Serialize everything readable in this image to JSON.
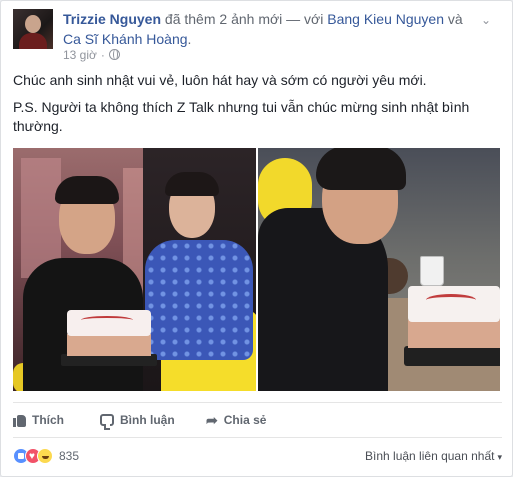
{
  "header": {
    "author": "Trizzie Nguyen",
    "action_text": "đã thêm 2 ảnh mới — với",
    "tagged_1": "Bang Kieu Nguyen",
    "conjunction": "và",
    "tagged_2": "Ca Sĩ Khánh Hoàng",
    "period": ".",
    "time": "13 giờ",
    "separator": "·"
  },
  "post": {
    "line_1": "Chúc anh sinh nhật vui vẻ, luôn hát hay và sớm có người yêu mới.",
    "line_2": "P.S. Người ta không thích Z Talk nhưng tui vẫn chúc mừng sinh nhật bình thường."
  },
  "actions": {
    "like_label": "Thích",
    "comment_label": "Bình luận",
    "share_label": "Chia sẻ"
  },
  "footer": {
    "reaction_count": "835",
    "relevant_label": "Bình luận liên quan nhất",
    "caret": "▾"
  },
  "icons": {
    "privacy": "globe-icon",
    "menu": "chevron-down-icon",
    "like": "thumbs-up-icon",
    "comment": "comment-icon",
    "share": "share-arrow-icon"
  },
  "colors": {
    "link_blue": "#365899",
    "secondary_text": "#90949c",
    "action_text": "#616770",
    "like_blue": "#5890ff",
    "love_red": "#f25268",
    "haha_yellow": "#fcd94f"
  }
}
